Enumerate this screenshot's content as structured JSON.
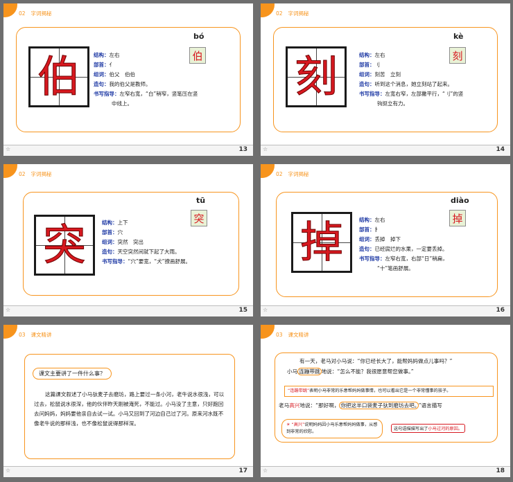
{
  "section_char": {
    "num": "02",
    "title": "字词揭秘"
  },
  "section_text": {
    "num": "03",
    "title": "课文精讲"
  },
  "labels": {
    "structure": "结构：",
    "radical": "部首：",
    "words": "组词：",
    "sentence": "造句：",
    "guide": "书写指导："
  },
  "slides": [
    {
      "page": "13",
      "char": "伯",
      "pinyin": "bó",
      "structure": "左右",
      "radical": "亻",
      "words": "伯父　伯伯",
      "sentence": "我的伯父是教师。",
      "guide1": "左窄右宽，“白”稍窄，竖笔压在竖",
      "guide2": "中线上。"
    },
    {
      "page": "14",
      "char": "刻",
      "pinyin": "kè",
      "structure": "左右",
      "radical": "刂",
      "words": "刻苦　立刻",
      "sentence": "听到这个消息，她立刻站了起来。",
      "guide1": "左宽右窄，左部撇平行，“刂”的竖",
      "guide2": "钩挺立有力。"
    },
    {
      "page": "15",
      "char": "突",
      "pinyin": "tū",
      "structure": "上下",
      "radical": "穴",
      "words": "突然　突出",
      "sentence": "天空突然间就下起了大雨。",
      "guide1": "“穴”要宽，“犬”撩画舒展。"
    },
    {
      "page": "16",
      "char": "掉",
      "pinyin": "diào",
      "structure": "左右",
      "radical": "扌",
      "words": "丢掉　掉下",
      "sentence": "已经腐烂的水果，一定要丢掉。",
      "guide1": "左窄右宽，右部“日”稍扁，",
      "guide2": "“十”笔画舒展。"
    }
  ],
  "slide17": {
    "page": "17",
    "question": "课文主要讲了一件什么事？",
    "paragraph": "这篇课文叙述了小马驮麦子去磨坊，路上要过一条小河，老牛说水很浅，可以过去，松鼠说水很深，他的伙伴昨天刚被淹死，不能过。小马没了主意，只好跑回去问妈妈，妈妈要他亲自去试一试。小马又回到了河边自己过了河。原来河水既不像老牛说的那样浅，也不像松鼠说得那样深。"
  },
  "slide18": {
    "page": "18",
    "line1": "有一天，老马对小马说：“你已经长大了，能帮妈妈做点儿事吗？”",
    "line2_a": "小马",
    "line2_b": "连蹦带跳",
    "line2_c": "地说：“怎么不能？我很愿意帮您做事。”",
    "note1_a": "“连蹦带跳”",
    "note1_b": "表明小马非常的乐意帮妈妈做事情，也可以看出它是一个非常懂事的孩子。",
    "line3_a": "老马",
    "line3_b": "高兴",
    "line3_c": "地说：“那好啊，",
    "line3_d": "你把这半口袋麦子驮到磨坊去吧。",
    "line3_e": "”语言描写",
    "cloud_a": "“高兴”",
    "cloud_b": "说明妈妈因小马乐意帮妈妈做事，从感到非常的欣慰。",
    "tag_a": "这句语描描写出了",
    "tag_b": "小马过河的原因。"
  }
}
